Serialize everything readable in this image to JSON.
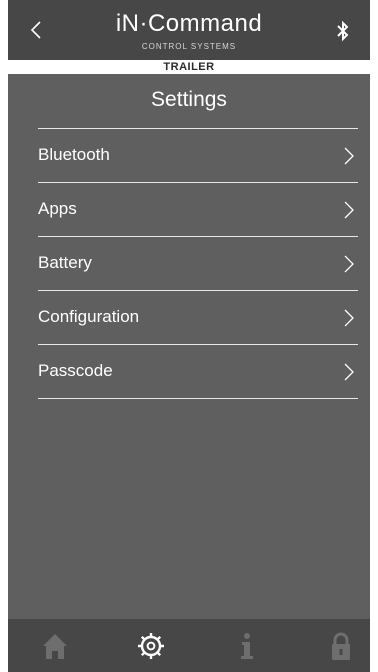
{
  "header": {
    "logo_main": "iN·Command",
    "logo_sub": "CONTROL SYSTEMS",
    "back_icon": "chevron-left-icon",
    "bluetooth_icon": "bluetooth-icon"
  },
  "banner": {
    "label": "TRAILER"
  },
  "page": {
    "title": "Settings"
  },
  "menu": {
    "items": [
      {
        "label": "Bluetooth"
      },
      {
        "label": "Apps"
      },
      {
        "label": "Battery"
      },
      {
        "label": "Configuration"
      },
      {
        "label": "Passcode"
      }
    ]
  },
  "bottom_nav": {
    "items": [
      {
        "icon": "home-icon",
        "active": false
      },
      {
        "icon": "gear-icon",
        "active": true
      },
      {
        "icon": "info-icon",
        "active": false
      },
      {
        "icon": "lock-icon",
        "active": false
      }
    ]
  },
  "colors": {
    "background": "#5f5f5f",
    "header": "#474747",
    "text": "#ffffff",
    "inactive_icon": "#6e6e6e"
  }
}
